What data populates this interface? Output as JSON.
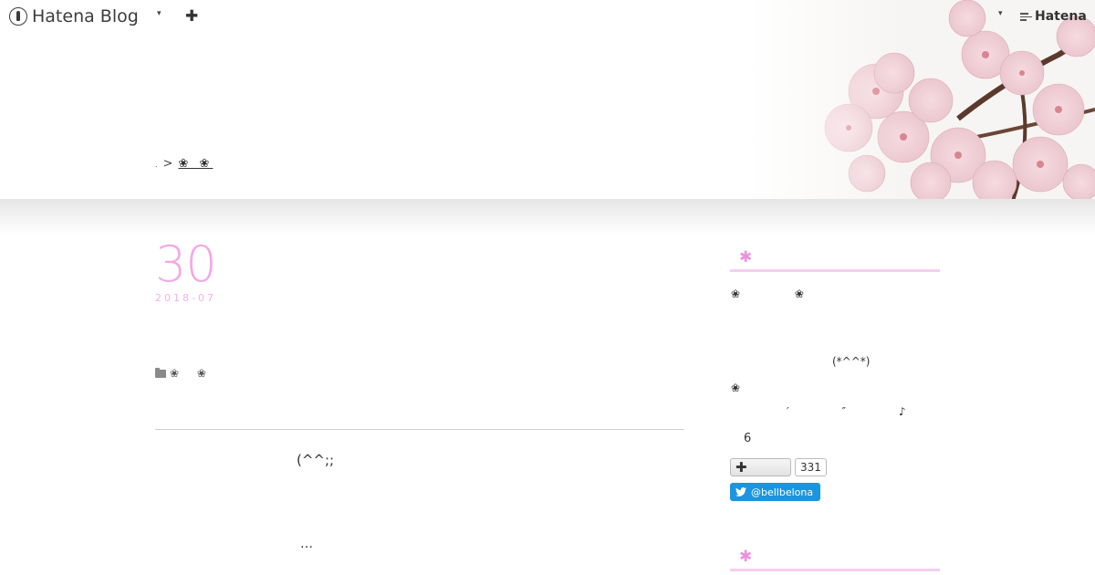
{
  "topbar": {
    "logo_text": "Hatena Blog",
    "left_dropdown_glyph": "▾",
    "add_glyph": "✚",
    "right_dropdown_glyph": "▾",
    "brand_text": "Hatena"
  },
  "breadcrumb": {
    "home": ".",
    "separator": ">",
    "current": "❀ ❀"
  },
  "entry": {
    "day": "30",
    "year_month": "2018-07",
    "category": "❀ ❀",
    "body_emote": "(^^;;",
    "body_ellipsis": "…"
  },
  "sidebar": {
    "module1_mark": "✱",
    "profile_flowers": "❀ ❀",
    "profile_emote": "(*^^*)",
    "profile_flower": "❀",
    "profile_marks": "′ ″ ♪",
    "profile_number": "6",
    "subscribe_glyph": "✚",
    "subscriber_count": "331",
    "twitter_handle": "@bellbelona",
    "module2_mark": "✱"
  },
  "colors": {
    "accent_pink": "#f3a9e6",
    "module_line": "#f6cdf0",
    "twitter_blue": "#1b95e0"
  }
}
